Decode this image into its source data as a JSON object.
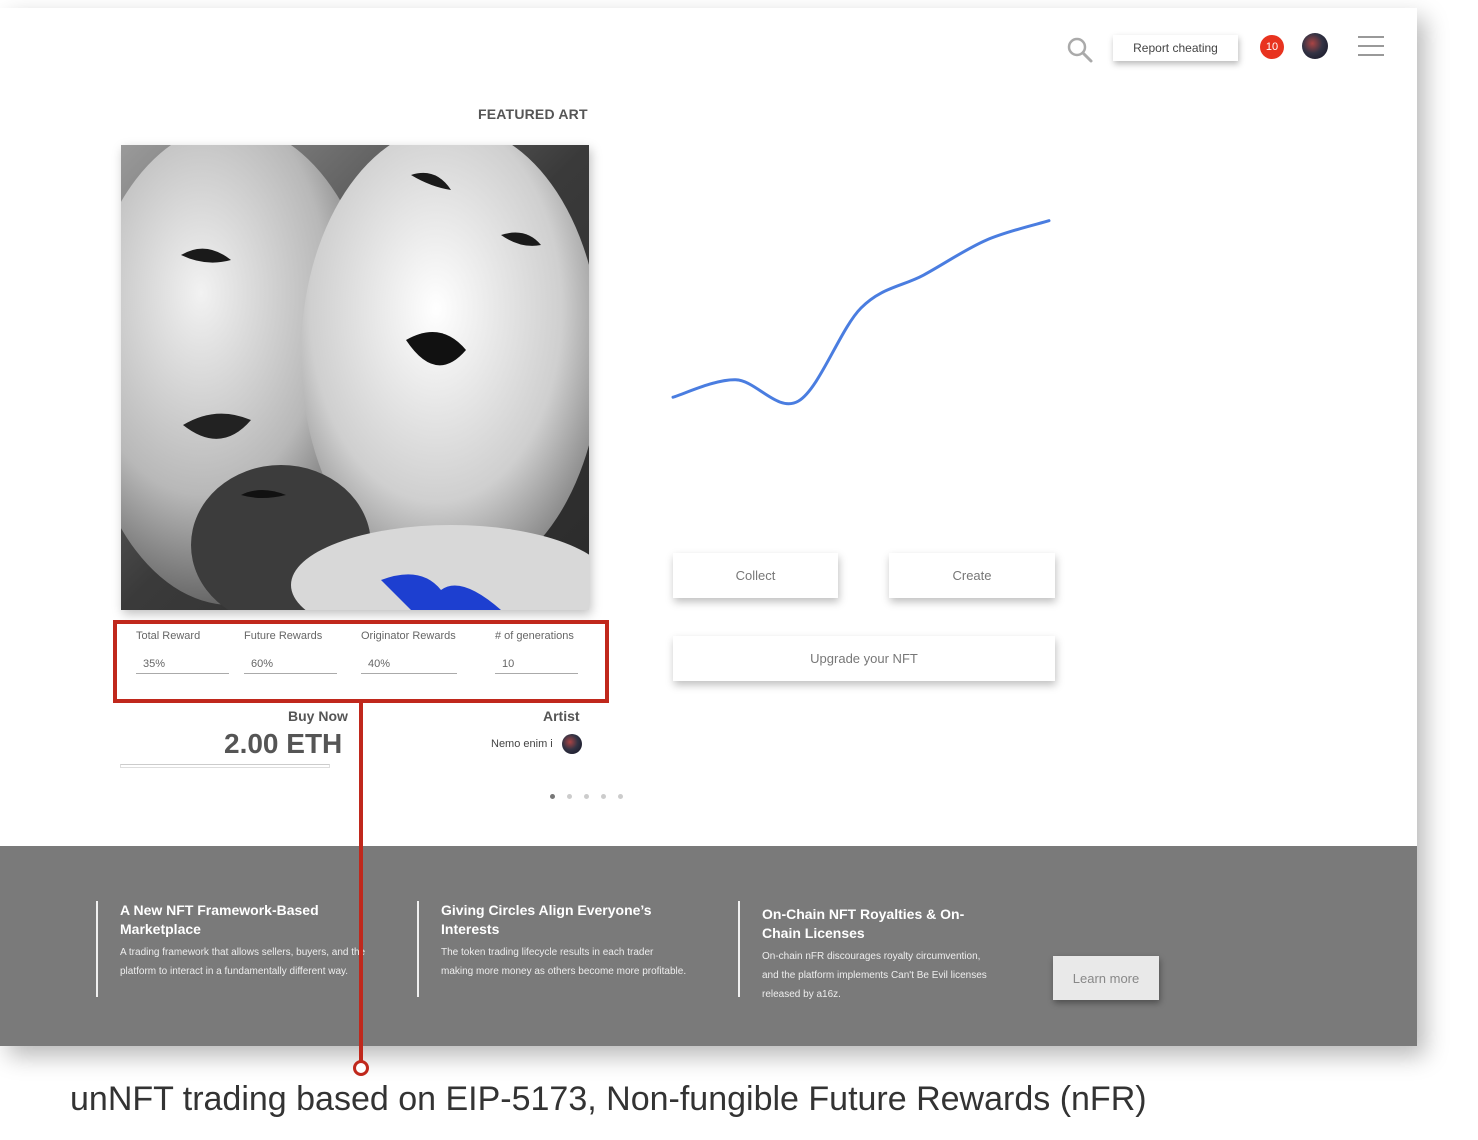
{
  "header": {
    "report_label": "Report cheating",
    "notification_count": "10"
  },
  "featured": {
    "title": "FEATURED ART"
  },
  "rewards": {
    "total": {
      "label": "Total Reward",
      "value": "35%"
    },
    "future": {
      "label": "Future Rewards",
      "value": "60%"
    },
    "originator": {
      "label": "Originator Rewards",
      "value": "40%"
    },
    "generations": {
      "label": "# of generations",
      "value": "10"
    }
  },
  "purchase": {
    "buy_label": "Buy Now",
    "price": "2.00 ETH"
  },
  "artist": {
    "heading": "Artist",
    "name": "Nemo enim i"
  },
  "carousel": {
    "count": 5,
    "active_index": 0
  },
  "chart_data": {
    "type": "line",
    "series": [
      {
        "values": [
          0.04,
          0.13,
          0.02,
          0.5,
          0.67,
          0.85,
          0.95
        ]
      }
    ],
    "color": "#4a7de0"
  },
  "actions": {
    "collect": "Collect",
    "create": "Create",
    "upgrade": "Upgrade your NFT"
  },
  "footer": {
    "col1": {
      "title": "A New NFT Framework-Based Marketplace",
      "text": "A trading framework that allows sellers, buyers, and the platform to interact in a fundamentally different way."
    },
    "col2": {
      "title": "Giving Circles Align Everyone’s Interests",
      "text": "The token trading lifecycle results in each trader making more money as others become more profitable."
    },
    "col3": {
      "title": "On-Chain NFT Royalties & On-Chain Licenses",
      "text": "On-chain nFR discourages royalty circumvention, and the platform implements Can't Be Evil licenses released by a16z."
    },
    "learn_more": "Learn more"
  },
  "annotation": {
    "caption": "unNFT trading based on EIP-5173, Non-fungible Future Rewards (nFR)",
    "color": "#c0281c"
  }
}
